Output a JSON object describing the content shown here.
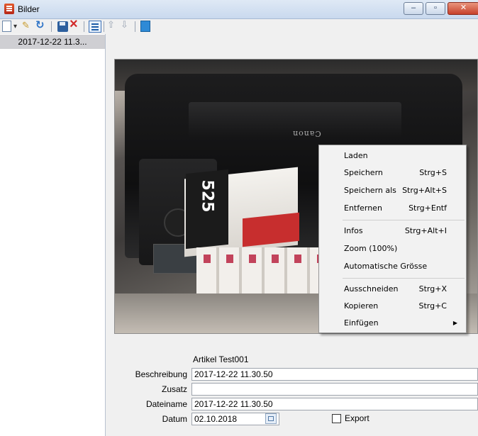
{
  "window": {
    "title": "Bilder"
  },
  "titlebar_controls": {
    "minimize": "–",
    "maximize": "▫",
    "close": "✕"
  },
  "toolbar": {
    "icons": [
      "new-icon",
      "dropdown-arrow-icon",
      "open-icon",
      "refresh-icon",
      "save-icon",
      "delete-icon",
      "list-view-icon",
      "move-up-icon",
      "move-down-icon",
      "properties-icon"
    ]
  },
  "list": {
    "items": [
      {
        "label": "2017-12-22 11.3..."
      }
    ]
  },
  "context_menu": {
    "groups": [
      [
        {
          "label": "Laden",
          "shortcut": ""
        },
        {
          "label": "Speichern",
          "shortcut": "Strg+S"
        },
        {
          "label": "Speichern als",
          "shortcut": "Strg+Alt+S"
        },
        {
          "label": "Entfernen",
          "shortcut": "Strg+Entf"
        }
      ],
      [
        {
          "label": "Infos",
          "shortcut": "Strg+Alt+I"
        },
        {
          "label": "Zoom (100%)",
          "shortcut": ""
        },
        {
          "label": "Automatische Grösse",
          "shortcut": ""
        }
      ],
      [
        {
          "label": "Ausschneiden",
          "shortcut": "Strg+X"
        },
        {
          "label": "Kopieren",
          "shortcut": "Strg+C"
        },
        {
          "label": "Einfügen",
          "shortcut": "",
          "submenu": true
        }
      ]
    ]
  },
  "photo": {
    "brand_text": "Canon",
    "box_text": "525"
  },
  "form": {
    "title": "Artikel Test001",
    "beschreibung_label": "Beschreibung",
    "beschreibung_value": "2017-12-22 11.30.50",
    "zusatz_label": "Zusatz",
    "zusatz_value": "",
    "dateiname_label": "Dateiname",
    "dateiname_value": "2017-12-22 11.30.50",
    "datum_label": "Datum",
    "datum_value": "02.10.2018",
    "export_label": "Export",
    "export_checked": false
  }
}
